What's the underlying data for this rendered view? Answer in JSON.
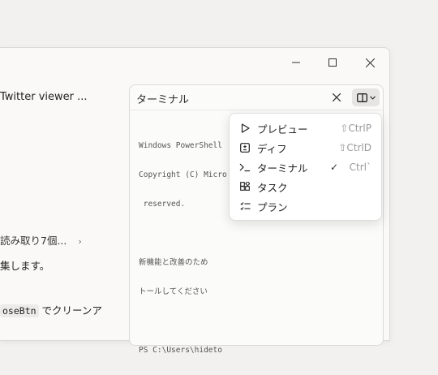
{
  "left_content": {
    "twitter_viewer": "Twitter viewer ...",
    "read_count": "読み取り7個...",
    "read_chevron": "›",
    "collect_text": "集します。",
    "clean_code": "oseBtn",
    "clean_text": " でクリーンア"
  },
  "panel": {
    "title": "ターミナル",
    "close_icon": "close-icon",
    "layout_icon": "panel-layout-icon"
  },
  "terminal": {
    "lines": [
      "Windows PowerShell",
      "Copyright (C) Micro",
      " reserved.",
      "",
      "新機能と改善のため",
      "トールしてください",
      "",
      "PS C:\\Users\\hideto"
    ]
  },
  "menu": {
    "items": [
      {
        "label": "プレビュー",
        "icon": "play-icon",
        "shortcut": "⇧CtrlP",
        "checked": false
      },
      {
        "label": "ディフ",
        "icon": "diff-icon",
        "shortcut": "⇧CtrlD",
        "checked": false
      },
      {
        "label": "ターミナル",
        "icon": "terminal-icon",
        "shortcut": "Ctrl`",
        "checked": true,
        "check_mark": "✓"
      },
      {
        "label": "タスク",
        "icon": "tasks-icon",
        "shortcut": "",
        "checked": false
      },
      {
        "label": "プラン",
        "icon": "plan-icon",
        "shortcut": "",
        "checked": false
      }
    ]
  },
  "colors": {
    "background": "#f2f1f0",
    "window": "#faf9f8",
    "menu_bg": "#ffffff",
    "shortcut_text": "#999999"
  }
}
